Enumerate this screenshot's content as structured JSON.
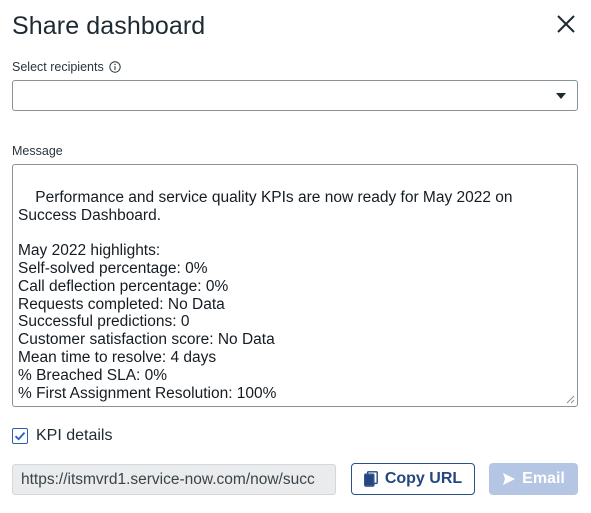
{
  "dialog": {
    "title": "Share dashboard"
  },
  "recipients": {
    "label": "Select recipients",
    "value": ""
  },
  "message": {
    "label": "Message",
    "text": "Performance and service quality KPIs are now ready for May 2022 on Success Dashboard.\n\nMay 2022 highlights:\nSelf-solved percentage: 0%\nCall deflection percentage: 0%\nRequests completed: No Data\nSuccessful predictions: 0\nCustomer satisfaction score: No Data\nMean time to resolve: 4 days\n% Breached SLA: 0%\n% First Assignment Resolution: 100%"
  },
  "kpi_details": {
    "label": "KPI details",
    "checked": true
  },
  "share_url": {
    "value": "https://itsmvrd1.service-now.com/now/succ"
  },
  "buttons": {
    "copy_url": "Copy URL",
    "email": "Email"
  },
  "colors": {
    "accent": "#2e5fb3",
    "email_disabled": "#b4c6e4",
    "url_bg": "#e9ebec"
  },
  "icons": {
    "close": "close-icon",
    "info": "info-icon",
    "dropdown": "caret-down-icon",
    "check": "checkmark-icon",
    "copy": "copy-icon",
    "send": "send-icon"
  }
}
